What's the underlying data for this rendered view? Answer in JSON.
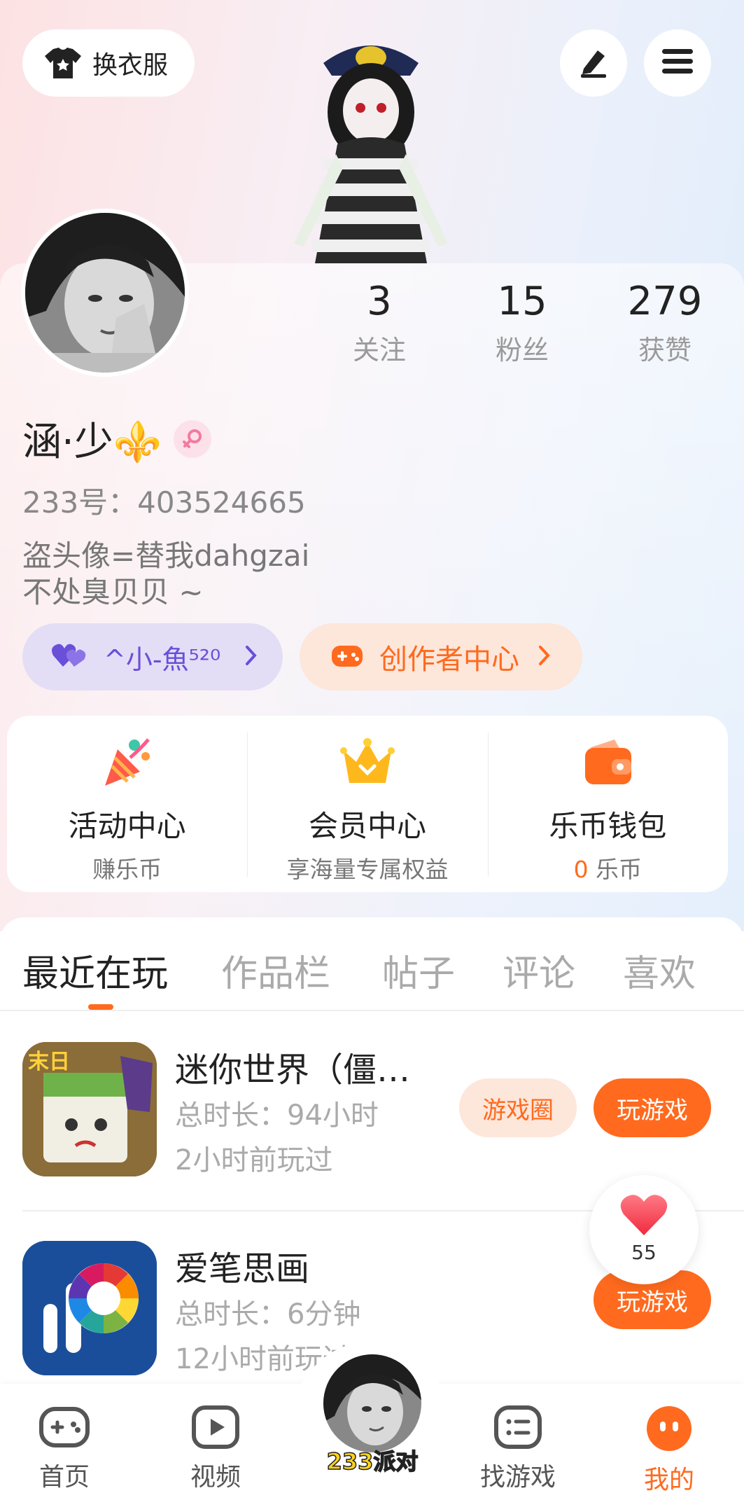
{
  "header": {
    "wardrobe_label": "换衣服",
    "edit_icon": "pencil-icon",
    "menu_icon": "hamburger-menu-icon"
  },
  "profile": {
    "stats": [
      {
        "value": "3",
        "label": "关注"
      },
      {
        "value": "15",
        "label": "粉丝"
      },
      {
        "value": "279",
        "label": "获赞"
      }
    ],
    "name": "涵·少⚜️",
    "gender_icon": "female-icon",
    "id_line": "233号：403524665",
    "bio_line1": "盗头像=替我dahgzai",
    "bio_line2": "不处臭贝贝 ~",
    "badge_friend": "^小-魚⁵²⁰",
    "badge_creator": "创作者中心"
  },
  "colors": {
    "accent": "#ff6a1e",
    "friend_badge_bg": "#e4ddf6",
    "friend_badge_text": "#6a4fd8",
    "creator_badge_bg": "#fde6da"
  },
  "quick_links": [
    {
      "icon": "party-popper-icon",
      "title": "活动中心",
      "sub": "赚乐币"
    },
    {
      "icon": "crown-icon",
      "title": "会员中心",
      "sub": "享海量专属权益"
    },
    {
      "icon": "wallet-icon",
      "title": "乐币钱包",
      "sub_value": "0",
      "sub": " 乐币"
    }
  ],
  "tabs": [
    "最近在玩",
    "作品栏",
    "帖子",
    "评论",
    "喜欢"
  ],
  "games": [
    {
      "name": "迷你世界（僵…",
      "duration": "总时长：94小时",
      "last_played": "2小时前玩过",
      "circle_label": "游戏圈",
      "play_label": "玩游戏"
    },
    {
      "name": "爱笔思画",
      "duration": "总时长：6分钟",
      "last_played": "12小时前玩过",
      "play_label": "玩游戏"
    }
  ],
  "floating_like": {
    "count": "55"
  },
  "bottom_nav": [
    {
      "label": "首页",
      "icon": "gamepad-icon"
    },
    {
      "label": "视频",
      "icon": "play-icon"
    },
    {
      "label": "233派对",
      "icon": "avatar-party-icon"
    },
    {
      "label": "找游戏",
      "icon": "list-icon"
    },
    {
      "label": "我的",
      "icon": "profile-dots-icon"
    }
  ]
}
